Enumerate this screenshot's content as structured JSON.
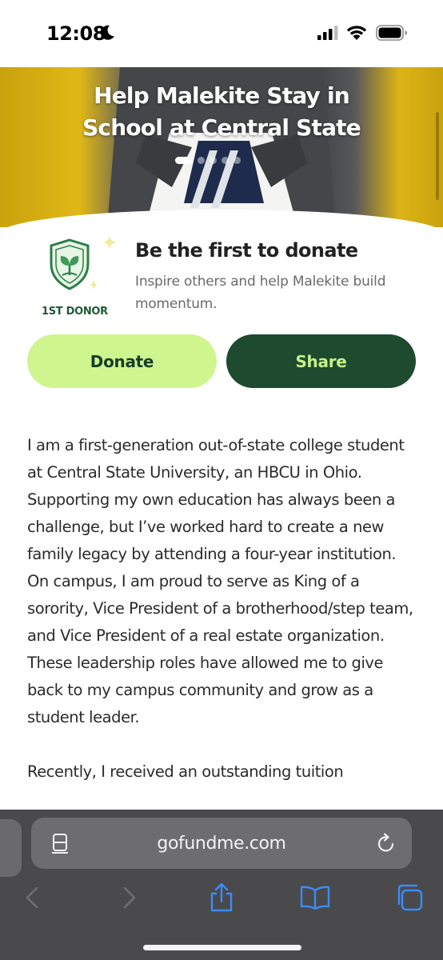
{
  "status_bar": {
    "time": "12:08"
  },
  "campaign": {
    "title_line1": "Help Malekite Stay in",
    "title_line2": "School at Central State"
  },
  "donor_promo": {
    "badge": "1ST DONOR",
    "title": "Be the first to donate",
    "subtitle": "Inspire others and help Malekite build momentum."
  },
  "actions": {
    "donate": "Donate",
    "share": "Share"
  },
  "story": {
    "paragraphs": [
      "I am a first-generation out-of-state college student at Central State University, an HBCU in Ohio. Supporting my own education has always been a challenge, but I’ve worked hard to create a new family legacy by attending a four-year institution. On campus, I am proud to serve as King of a sorority, Vice President of a brotherhood/step team, and Vice President of a real estate organization. These leadership roles have allowed me to give back to my campus community and grow as a student leader.",
      "Recently, I received an outstanding tuition"
    ]
  },
  "browser": {
    "url": "gofundme.com"
  },
  "colors": {
    "donate_bg": "#cff58f",
    "share_bg": "#1e4a30",
    "brand_green": "#1f5a35",
    "ios_blue": "#3a8cff"
  },
  "icons": [
    "moon-icon",
    "cellular-signal-icon",
    "wifi-icon",
    "battery-icon",
    "shield-sprout-icon",
    "sparkle-icon",
    "reader-icon",
    "reload-icon",
    "back-icon",
    "forward-icon",
    "share-icon",
    "bookmarks-icon",
    "tabs-icon"
  ]
}
